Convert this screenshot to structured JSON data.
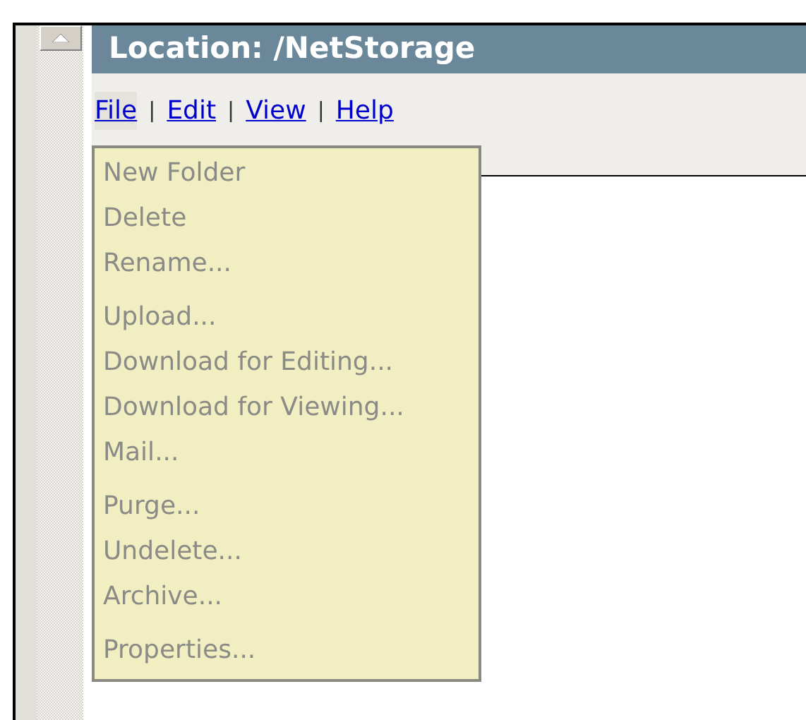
{
  "location_bar": {
    "title": "Location: /NetStorage"
  },
  "menu_bar": [
    {
      "label": "File",
      "open": true
    },
    {
      "label": "Edit",
      "open": false
    },
    {
      "label": "View",
      "open": false
    },
    {
      "label": "Help",
      "open": false
    }
  ],
  "menu_separator": "|",
  "file_menu": {
    "groups": [
      {
        "items": [
          {
            "label": "New Folder",
            "disabled": true
          },
          {
            "label": "Delete",
            "disabled": true
          },
          {
            "label": "Rename...",
            "disabled": true
          }
        ]
      },
      {
        "items": [
          {
            "label": "Upload...",
            "disabled": true
          },
          {
            "label": "Download for Editing...",
            "disabled": true
          },
          {
            "label": "Download for Viewing...",
            "disabled": true
          },
          {
            "label": "Mail...",
            "disabled": true
          }
        ]
      },
      {
        "items": [
          {
            "label": "Purge...",
            "disabled": true
          },
          {
            "label": "Undelete...",
            "disabled": true
          },
          {
            "label": "Archive...",
            "disabled": true
          }
        ]
      },
      {
        "items": [
          {
            "label": "Properties...",
            "disabled": true
          }
        ]
      }
    ]
  }
}
